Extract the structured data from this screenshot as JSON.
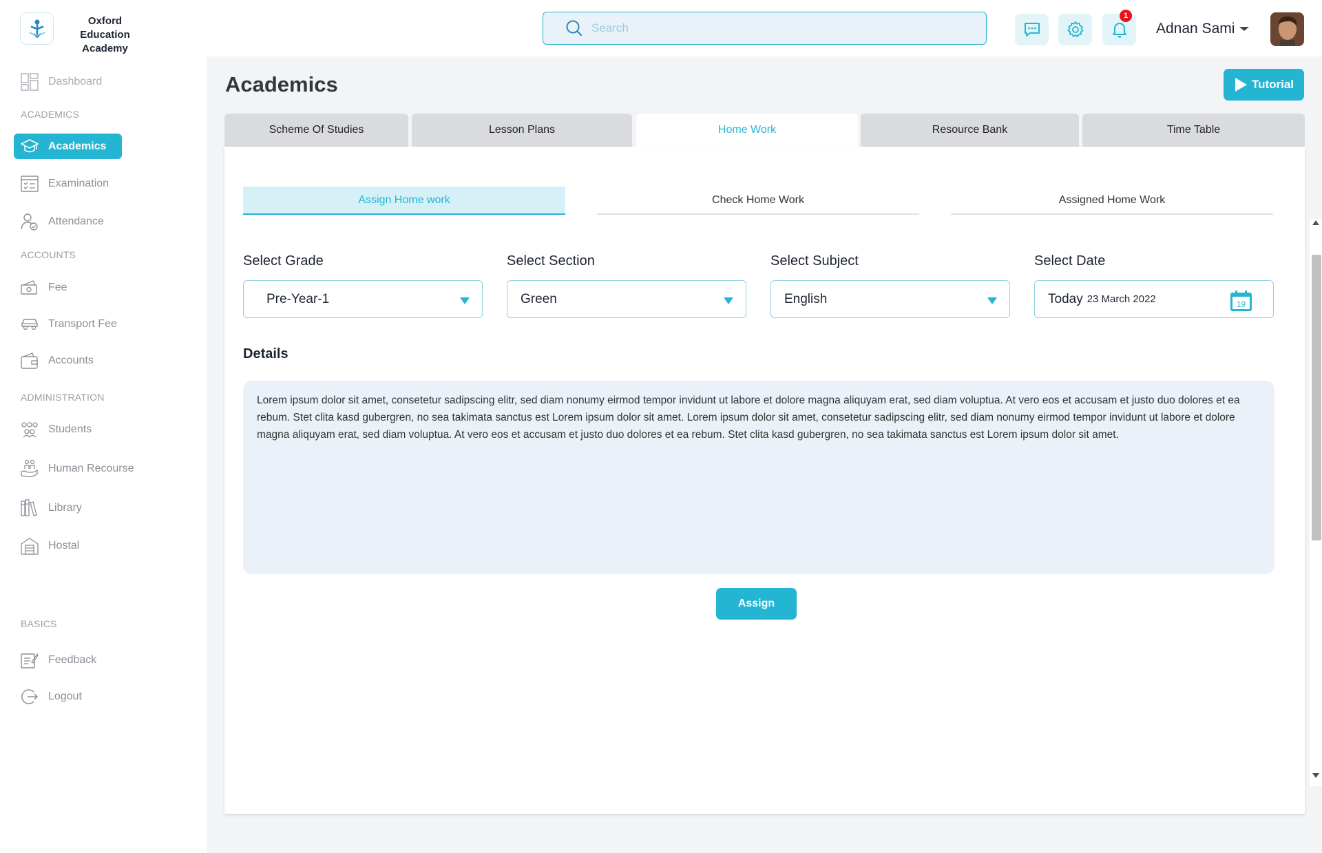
{
  "header": {
    "brand_line1": "Oxford Education",
    "brand_line2": "Academy",
    "search_placeholder": "Search",
    "notification_count": "1",
    "user_name": "Adnan Sami"
  },
  "sidebar": {
    "dashboard": "Dashboard",
    "section_academics": "ACADEMICS",
    "academics": "Academics",
    "examination": "Examination",
    "attendance": "Attendance",
    "section_accounts": "ACCOUNTS",
    "fee": "Fee",
    "transport_fee": "Transport Fee",
    "accounts": "Accounts",
    "section_administration": "ADMINISTRATION",
    "students": "Students",
    "human_resource": "Human Recourse",
    "library": "Library",
    "hostal": "Hostal",
    "section_basics": "BASICS",
    "feedback": "Feedback",
    "logout": "Logout"
  },
  "page": {
    "title": "Academics",
    "tutorial_label": "Tutorial"
  },
  "tabs": [
    {
      "label": "Scheme Of Studies"
    },
    {
      "label": "Lesson Plans"
    },
    {
      "label": "Home Work"
    },
    {
      "label": "Resource Bank"
    },
    {
      "label": "Time Table"
    }
  ],
  "subtabs": [
    {
      "label": "Assign Home work"
    },
    {
      "label": "Check Home Work"
    },
    {
      "label": "Assigned Home Work"
    }
  ],
  "form": {
    "grade_label": "Select Grade",
    "grade_value": "Pre-Year-1",
    "section_label": "Select Section",
    "section_value": "Green",
    "subject_label": "Select Subject",
    "subject_value": "English",
    "date_label": "Select Date",
    "date_main": "Today",
    "date_sub": "23 March 2022",
    "calendar_day": "19",
    "details_label": "Details",
    "details_text": "Lorem ipsum dolor sit amet, consetetur sadipscing elitr, sed diam nonumy eirmod tempor invidunt ut labore et dolore magna aliquyam erat, sed diam voluptua. At vero eos et accusam et justo duo dolores et ea rebum. Stet clita kasd gubergren, no sea takimata sanctus est Lorem ipsum dolor sit amet. Lorem ipsum dolor sit amet, consetetur sadipscing elitr, sed diam nonumy eirmod tempor invidunt ut labore et dolore magna aliquyam erat, sed diam voluptua. At vero eos et accusam et justo duo dolores et ea rebum. Stet clita kasd gubergren, no sea takimata sanctus est Lorem ipsum dolor sit amet.",
    "assign_label": "Assign"
  },
  "colors": {
    "accent": "#24b5d3",
    "notification": "#e8141c"
  }
}
